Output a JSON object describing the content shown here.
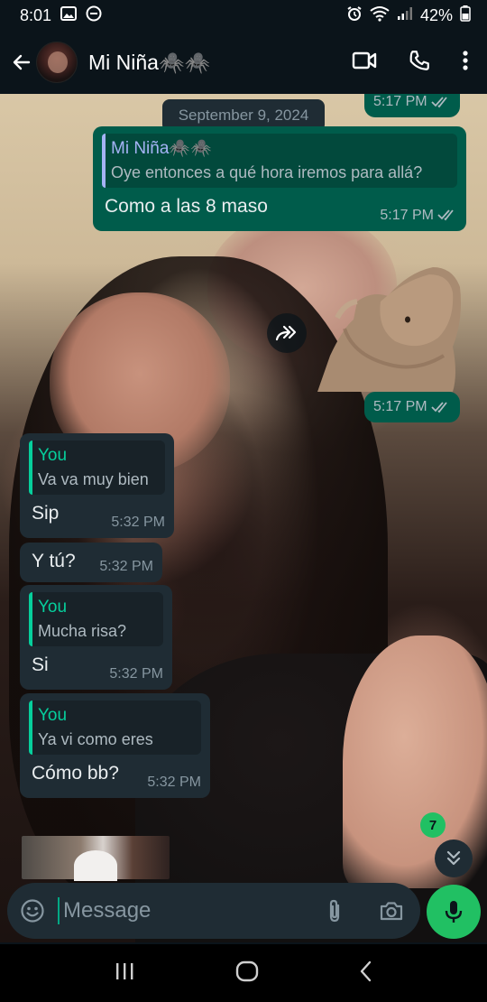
{
  "status_bar": {
    "time": "8:01",
    "battery": "42%"
  },
  "header": {
    "contact_name": "Mi Niña🕷️🕷️"
  },
  "chat": {
    "date_chip": "September 9, 2024",
    "top_partial_time": "5:17 PM",
    "messages": [
      {
        "direction": "out",
        "quote_author": "Mi Niña🕷️🕷️",
        "quote_text": "Oye entonces a qué hora iremos para allá?",
        "text": "Como a las 8 maso",
        "time": "5:17 PM",
        "read": true
      },
      {
        "direction": "out",
        "type": "sticker",
        "time": "5:17 PM",
        "read": true
      },
      {
        "direction": "in",
        "quote_author": "You",
        "quote_text": "Va va muy bien",
        "text": "Sip",
        "time": "5:32 PM"
      },
      {
        "direction": "in",
        "text": "Y tú?",
        "time": "5:32 PM"
      },
      {
        "direction": "in",
        "quote_author": "You",
        "quote_text": "Mucha risa?",
        "text": "Si",
        "time": "5:32 PM"
      },
      {
        "direction": "in",
        "quote_author": "You",
        "quote_text": "Ya vi como eres",
        "text": "Cómo bb?",
        "time": "5:32 PM"
      }
    ],
    "unread_count": "7"
  },
  "composer": {
    "placeholder": "Message"
  },
  "colors": {
    "outgoing_bubble": "#005c4b",
    "incoming_bubble": "#1f2c34",
    "accent_green": "#21c063",
    "read_ticks": "#aebac1"
  },
  "icons": {
    "back": "arrow-left-icon",
    "video": "video-camera-icon",
    "call": "phone-icon",
    "menu": "kebab-menu-icon",
    "emoji": "smiley-icon",
    "attach": "paperclip-icon",
    "camera": "camera-icon",
    "mic": "microphone-icon",
    "forward": "forward-icon",
    "scroll_down": "chevrons-down-icon"
  }
}
